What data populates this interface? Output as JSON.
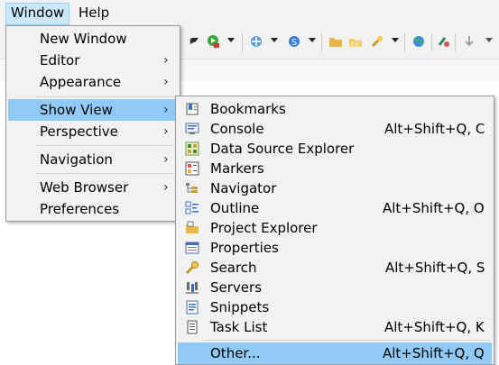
{
  "menubar": {
    "items": [
      {
        "label": "Window"
      },
      {
        "label": "Help"
      }
    ]
  },
  "window_menu": {
    "items": [
      {
        "label": "New Window"
      },
      {
        "label": "Editor",
        "submenu_arrow": "›"
      },
      {
        "label": "Appearance",
        "submenu_arrow": "›"
      },
      {
        "label": "Show View",
        "submenu_arrow": "›",
        "highlighted": true
      },
      {
        "label": "Perspective",
        "submenu_arrow": "›"
      },
      {
        "label": "Navigation",
        "submenu_arrow": "›"
      },
      {
        "label": "Web Browser",
        "submenu_arrow": "›"
      },
      {
        "label": "Preferences"
      }
    ]
  },
  "show_view_menu": {
    "items": [
      {
        "label": "Bookmarks",
        "accel": "",
        "icon": "bookmarks-icon"
      },
      {
        "label": "Console",
        "accel": "Alt+Shift+Q, C",
        "icon": "console-icon"
      },
      {
        "label": "Data Source Explorer",
        "accel": "",
        "icon": "data-source-explorer-icon"
      },
      {
        "label": "Markers",
        "accel": "",
        "icon": "markers-icon"
      },
      {
        "label": "Navigator",
        "accel": "",
        "icon": "navigator-icon"
      },
      {
        "label": "Outline",
        "accel": "Alt+Shift+Q, O",
        "icon": "outline-icon"
      },
      {
        "label": "Project Explorer",
        "accel": "",
        "icon": "project-explorer-icon"
      },
      {
        "label": "Properties",
        "accel": "",
        "icon": "properties-icon"
      },
      {
        "label": "Search",
        "accel": "Alt+Shift+Q, S",
        "icon": "search-icon"
      },
      {
        "label": "Servers",
        "accel": "",
        "icon": "servers-icon"
      },
      {
        "label": "Snippets",
        "accel": "",
        "icon": "snippets-icon"
      },
      {
        "label": "Task List",
        "accel": "Alt+Shift+Q, K",
        "icon": "task-list-icon"
      },
      {
        "label": "Other...",
        "accel": "Alt+Shift+Q, Q",
        "highlighted": true
      }
    ]
  },
  "colors": {
    "menu_bg": "#f2f2f2",
    "highlight": "#91c9f7",
    "menubar_active": "#cce8ff"
  }
}
